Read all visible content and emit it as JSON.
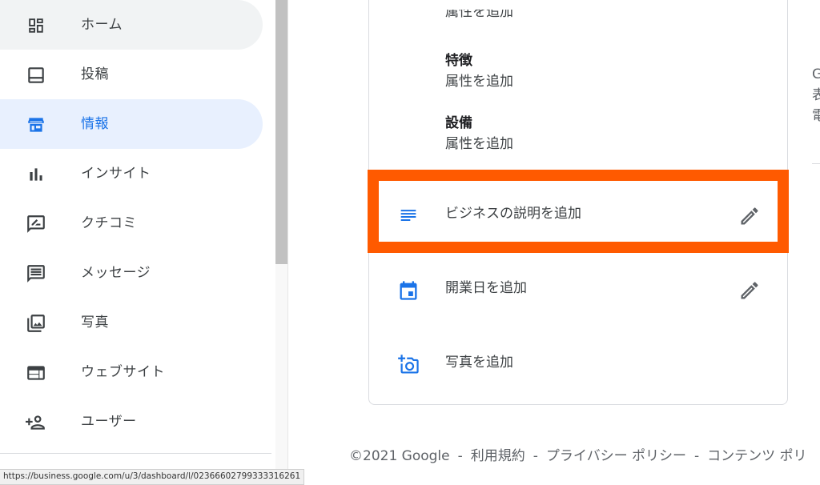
{
  "sidebar": {
    "items": [
      {
        "label": "ホーム",
        "icon": "dashboard-icon",
        "state": "hover"
      },
      {
        "label": "投稿",
        "icon": "posts-icon",
        "state": "normal"
      },
      {
        "label": "情報",
        "icon": "storefront-icon",
        "state": "active"
      },
      {
        "label": "インサイト",
        "icon": "bar-chart-icon",
        "state": "normal"
      },
      {
        "label": "クチコミ",
        "icon": "rate-review-icon",
        "state": "normal"
      },
      {
        "label": "メッセージ",
        "icon": "message-icon",
        "state": "normal"
      },
      {
        "label": "写真",
        "icon": "photo-library-icon",
        "state": "normal"
      },
      {
        "label": "ウェブサイト",
        "icon": "web-icon",
        "state": "normal"
      },
      {
        "label": "ユーザー",
        "icon": "person-add-icon",
        "state": "normal"
      }
    ]
  },
  "status_bar": {
    "url": "https://business.google.com/u/3/dashboard/l/02366602799333316261"
  },
  "card": {
    "cut_off_text": "属性を追加",
    "attributes": [
      {
        "title": "特徴",
        "value": "属性を追加"
      },
      {
        "title": "設備",
        "value": "属性を追加"
      }
    ],
    "rows": [
      {
        "label": "ビジネスの説明を追加",
        "icon": "subject-icon",
        "editable": true,
        "highlighted": true
      },
      {
        "label": "開業日を追加",
        "icon": "event-icon",
        "editable": true,
        "highlighted": false
      },
      {
        "label": "写真を追加",
        "icon": "add-a-photo-icon",
        "editable": false,
        "highlighted": false
      }
    ]
  },
  "right_column": {
    "lines": [
      "G",
      "表",
      "電"
    ]
  },
  "footer": {
    "copyright": "©2021 Google",
    "links": [
      "利用規約",
      "プライバシー ポリシー",
      "コンテンツ ポリ"
    ],
    "separator": "-"
  },
  "colors": {
    "accent": "#1a73e8",
    "active_bg": "#e8f0fe",
    "hover_bg": "#f1f3f4",
    "highlight": "#ff5a00",
    "icon_gray": "#3c4043"
  }
}
